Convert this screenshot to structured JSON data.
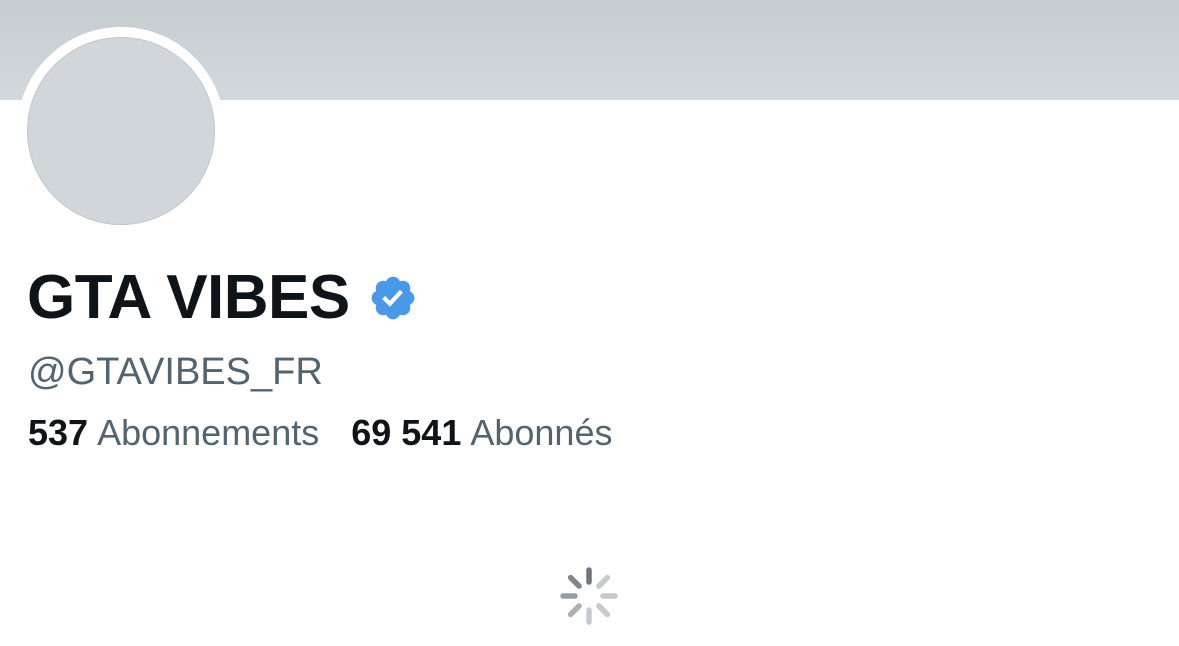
{
  "profile": {
    "display_name": "GTA VIBES",
    "verified": true,
    "verified_icon": "verified-badge-icon",
    "handle": "@GTAVIBES_FR",
    "stats": {
      "following_count": "537",
      "following_label": "Abonnements",
      "followers_count": "69 541",
      "followers_label": "Abonnés"
    }
  },
  "colors": {
    "banner": "#c9d0d3",
    "avatar_placeholder": "#d0d6da",
    "verified_blue": "#4a99e9",
    "text_primary": "#0f1419",
    "text_secondary": "#536471",
    "spinner": "#9aa3a8"
  },
  "loading_icon": "loading-spinner-icon"
}
